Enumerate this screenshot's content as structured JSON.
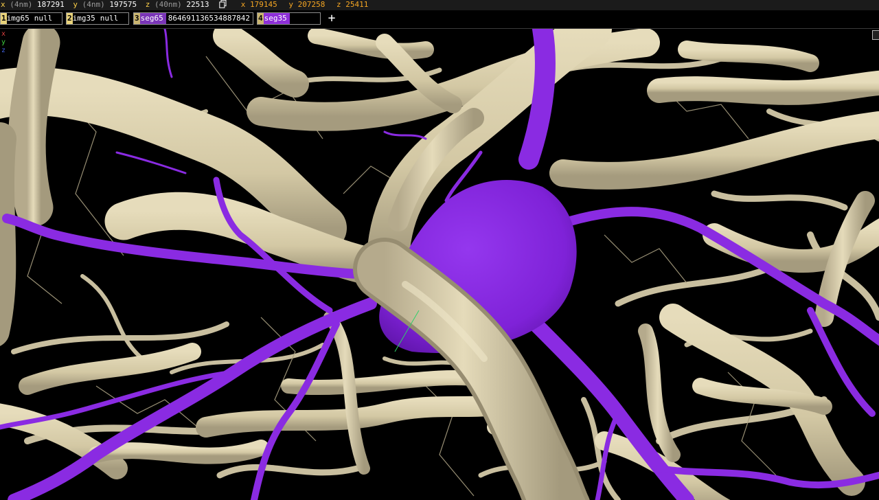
{
  "coords": {
    "position": [
      {
        "axis": "x",
        "unit": "(4nm)",
        "value": "187291"
      },
      {
        "axis": "y",
        "unit": "(4nm)",
        "value": "197575"
      },
      {
        "axis": "z",
        "unit": "(40nm)",
        "value": "22513"
      }
    ],
    "mouse": [
      {
        "axis": "x",
        "value": "179145"
      },
      {
        "axis": "y",
        "value": "207258"
      },
      {
        "axis": "z",
        "value": "25411"
      }
    ]
  },
  "layers": [
    {
      "number": "1",
      "name": "img65",
      "value": "null",
      "color": "#e8d27a"
    },
    {
      "number": "2",
      "name": "img35",
      "value": "null",
      "color": "#e8d27a"
    },
    {
      "number": "3",
      "name": "seg65",
      "value": "864691136534887842",
      "color": "#c9b46e",
      "highlight": "#7a35b8"
    },
    {
      "number": "4",
      "name": "seg35",
      "value": "",
      "color": "#c9b46e",
      "highlight": "#8e2fd8"
    }
  ],
  "add_layer_label": "+",
  "axis_indicator": [
    "x",
    "y",
    "z"
  ],
  "colors": {
    "vessel": "#d8ceac",
    "vessel_shade": "#9e9478",
    "neuron": "#8a2be2",
    "neuron_shade": "#5b16a0",
    "background": "#000000"
  }
}
